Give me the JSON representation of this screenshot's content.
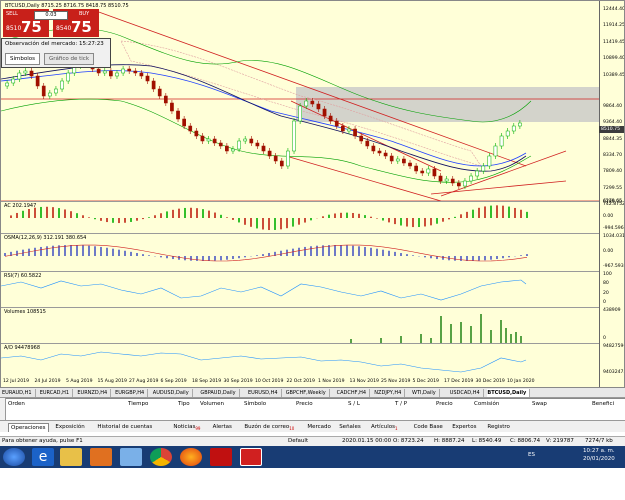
{
  "chart": {
    "symbol_line": "BTCUSD,Daily  8715.25 8716.75 8418.75 8510.75",
    "y_labels": [
      "12444.40",
      "11914.25",
      "11419.45",
      "10899.40",
      "10389.45",
      "9864.40",
      "9364.40",
      "8844.35",
      "8334.70",
      "7809.40",
      "7299.55",
      "6789.70",
      "6279.65"
    ],
    "current_price": "8510.75",
    "current_price_color": "#3c3c3c",
    "x_labels": [
      "12 Jul 2019",
      "24 Jul 2019",
      "5 Aug 2019",
      "15 Aug 2019",
      "27 Aug 2019",
      "6 Sep 2019",
      "18 Sep 2019",
      "30 Sep 2019",
      "10 Oct 2019",
      "22 Oct 2019",
      "1 Nov 2019",
      "13 Nov 2019",
      "25 Nov 2019",
      "5 Dec 2019",
      "17 Dec 2019",
      "30 Dec 2019",
      "10 Jan 2020"
    ],
    "ac_label": "AC 202.1947",
    "ac_scale": [
      "742.8752",
      "0.00",
      "-994.5968"
    ],
    "rsi_label": "RSI(7) 60.5822",
    "rsi_scale": [
      "100",
      "80",
      "20",
      "0"
    ],
    "volumes_label": "Volumes 108515",
    "volumes_scale": [
      "438909",
      "0"
    ],
    "ad_label": "A/D 94478968",
    "ad_scale": [
      "94827596",
      "94032475"
    ],
    "osma_label": "OSMA(12,26,9) 312.191 380.654",
    "osma_scale": [
      "1034.031",
      "0.00",
      "-967.593"
    ],
    "bull_color": "#00b000",
    "bear_color": "#a01000",
    "resistance_band_color": "#c8c8c8"
  },
  "trade_panel": {
    "sell_label": "SELL",
    "sell_small": "8510",
    "sell_big": "75",
    "buy_label": "BUY",
    "buy_small": "8540",
    "buy_big": "75",
    "lot": "0.03",
    "accent": "#c8201a"
  },
  "market_watch": {
    "title": "Observación del mercado: 15:27:23",
    "tab_symbols": "Símbolos",
    "tab_tick": "Gráfico de tick"
  },
  "symbol_tabs": [
    "EURAUD,H1",
    "EURCAD,H1",
    "EURNZD,H4",
    "EURGBP,H4",
    "AUDUSD,Daily",
    "GBPAUD,Daily",
    "EURUSD,H4",
    "GBPCHF,Weekly",
    "CADCHF,H4",
    "NZDJPY,H4",
    "WTI,Daily",
    "USDCAD,H4",
    "BTCUSD,Daily"
  ],
  "terminal": {
    "headers": [
      "Orden",
      "Tiempo",
      "Tipo",
      "Volumen",
      "Símbolo",
      "Precio",
      "S / L",
      "T / P",
      "Precio",
      "Comisión",
      "Swap",
      "Benefici"
    ],
    "tabs": [
      {
        "label": "Operaciones",
        "badge": ""
      },
      {
        "label": "Exposición",
        "badge": ""
      },
      {
        "label": "Historial de cuentas",
        "badge": ""
      },
      {
        "label": "Noticias",
        "badge": "99"
      },
      {
        "label": "Alertas",
        "badge": ""
      },
      {
        "label": "Buzón de correo",
        "badge": "10"
      },
      {
        "label": "Mercado",
        "badge": ""
      },
      {
        "label": "Señales",
        "badge": ""
      },
      {
        "label": "Artículos",
        "badge": "1"
      },
      {
        "label": "Code Base",
        "badge": ""
      },
      {
        "label": "Expertos",
        "badge": ""
      },
      {
        "label": "Registro",
        "badge": ""
      }
    ],
    "side_label": "Terminal"
  },
  "statusbar": {
    "help": "Para obtener ayuda, pulse F1",
    "profile": "Default",
    "datetime": "2020.01.15 00:00",
    "open": "O: 8723.24",
    "high": "H: 8887.24",
    "low": "L: 8540.49",
    "close": "C: 8806.74",
    "volume": "V: 219787",
    "traffic": "7274/7 kb"
  },
  "taskbar": {
    "icons": [
      "windows-start",
      "internet-explorer",
      "file-explorer",
      "media-player",
      "paint",
      "chrome",
      "firefox",
      "pdf-reader",
      "metatrader"
    ],
    "lang": "ES",
    "time": "10:27 a. m.",
    "date": "20/01/2020"
  }
}
